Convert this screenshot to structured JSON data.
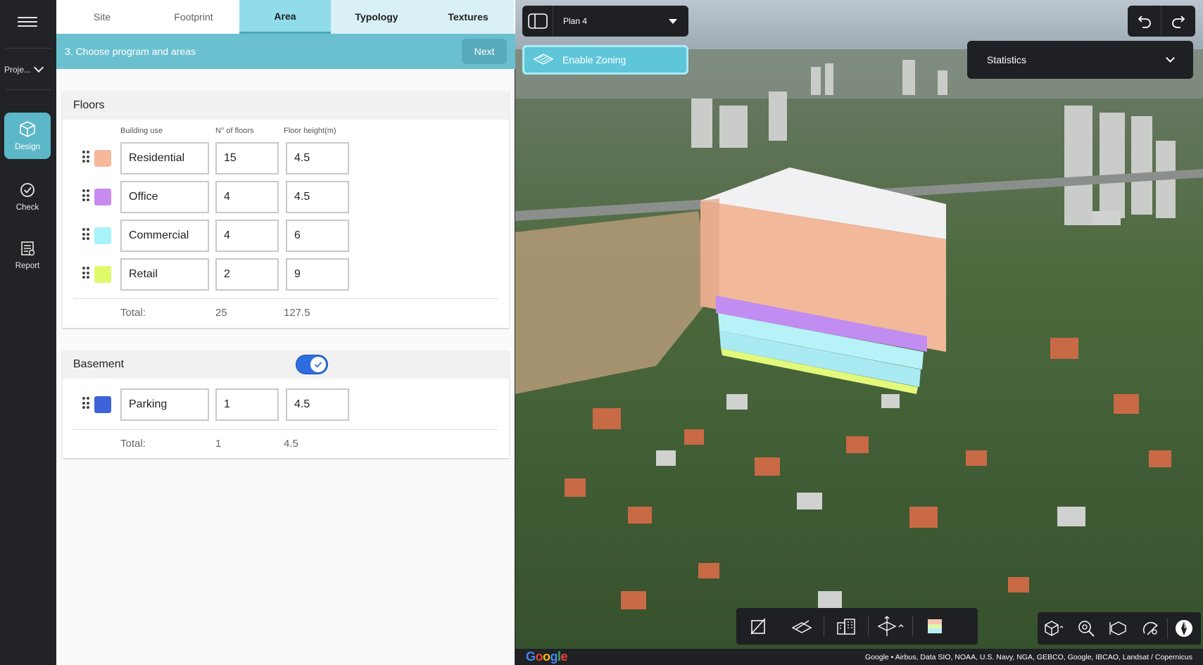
{
  "rail": {
    "project_label": "Proje...",
    "items": [
      {
        "label": "Design"
      },
      {
        "label": "Check"
      },
      {
        "label": "Report"
      }
    ]
  },
  "tabs": [
    "Site",
    "Footprint",
    "Area",
    "Typology",
    "Textures"
  ],
  "step": {
    "title": "3. Choose program and areas",
    "next_label": "Next"
  },
  "floors": {
    "title": "Floors",
    "columns": {
      "use": "Building use",
      "floors": "N° of floors",
      "height": "Floor height(m)"
    },
    "rows": [
      {
        "use": "Residential",
        "floors": "15",
        "height": "4.5",
        "color": "#f6b89a"
      },
      {
        "use": "Office",
        "floors": "4",
        "height": "4.5",
        "color": "#c98af0"
      },
      {
        "use": "Commercial",
        "floors": "4",
        "height": "6",
        "color": "#a8f3fa"
      },
      {
        "use": "Retail",
        "floors": "2",
        "height": "9",
        "color": "#dffb6c"
      }
    ],
    "total": {
      "label": "Total:",
      "floors": "25",
      "height": "127.5"
    }
  },
  "basement": {
    "title": "Basement",
    "enabled": true,
    "rows": [
      {
        "use": "Parking",
        "floors": "1",
        "height": "4.5",
        "color": "#3e63d9"
      }
    ],
    "total": {
      "label": "Total:",
      "floors": "1",
      "height": "4.5"
    }
  },
  "map": {
    "plan": "Plan 4",
    "zoning_label": "Enable Zoning",
    "statistics_label": "Statistics",
    "google_logo": "Google",
    "credits": "Google • Airbus, Data SIO, NOAA, U.S. Navy, NGA, GEBCO, Google, IBCAO, Landsat / Copernicus"
  }
}
